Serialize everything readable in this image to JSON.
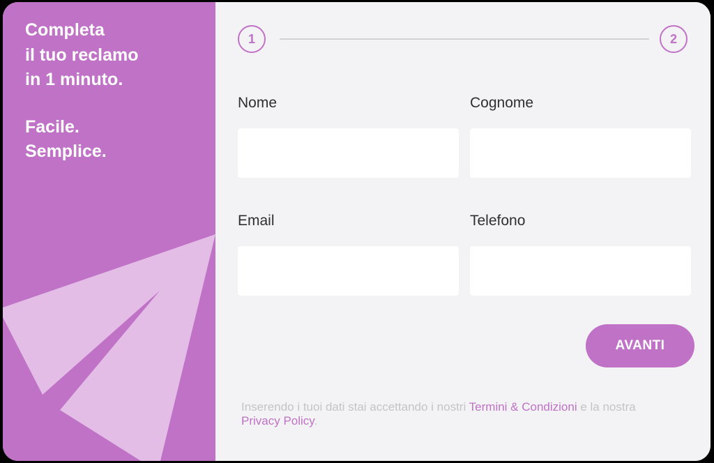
{
  "promo": {
    "lines": [
      "Completa",
      "il tuo reclamo",
      "in 1 minuto."
    ],
    "tagline": [
      "Facile.",
      "Semplice."
    ]
  },
  "stepper": {
    "steps": [
      "1",
      "2"
    ]
  },
  "form": {
    "first_name": {
      "label": "Nome",
      "value": "",
      "placeholder": ""
    },
    "last_name": {
      "label": "Cognome",
      "value": "",
      "placeholder": ""
    },
    "email": {
      "label": "Email",
      "value": "",
      "placeholder": ""
    },
    "phone": {
      "label": "Telefono",
      "value": "",
      "placeholder": ""
    },
    "next_label": "AVANTI"
  },
  "legal": {
    "prefix": "Inserendo i tuoi dati stai accettando i nostri ",
    "terms_link": "Termini & Condizioni",
    "middle": " e la nostra",
    "privacy_link": "Privacy Policy",
    "suffix": "."
  },
  "colors": {
    "accent": "#bf72c6",
    "plane": "#e3bde6",
    "panel_bg": "#f3f3f5",
    "label_text": "#2f2f33",
    "legal_text": "#c4c4c8"
  },
  "icons": {
    "decoration": "paper-plane-icon"
  }
}
